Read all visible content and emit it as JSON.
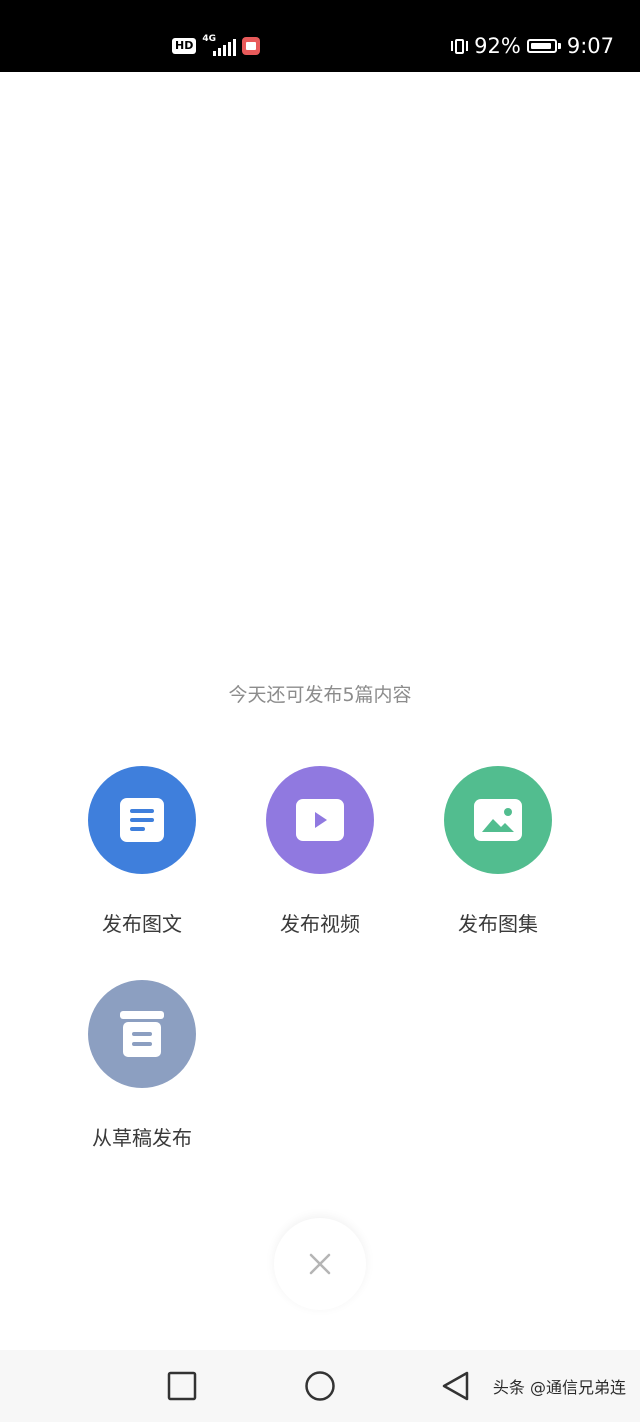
{
  "status_bar": {
    "hd": "HD",
    "network": "4G",
    "battery": "92%",
    "battery_level": 0.92,
    "time": "9:07"
  },
  "quota_text": "今天还可发布5篇内容",
  "actions": [
    {
      "label": "发布图文",
      "icon": "article-icon",
      "color": "#3f7fdc"
    },
    {
      "label": "发布视频",
      "icon": "video-play-icon",
      "color": "#9079e0"
    },
    {
      "label": "发布图集",
      "icon": "image-icon",
      "color": "#52bd8f"
    },
    {
      "label": "从草稿发布",
      "icon": "archive-box-icon",
      "color": "#8c9fc1"
    }
  ],
  "close": {
    "icon": "close-icon"
  },
  "nav": {
    "recent_icon": "square-icon",
    "home_icon": "circle-icon",
    "back_icon": "triangle-back-icon"
  },
  "watermark": "头条 @通信兄弟连"
}
